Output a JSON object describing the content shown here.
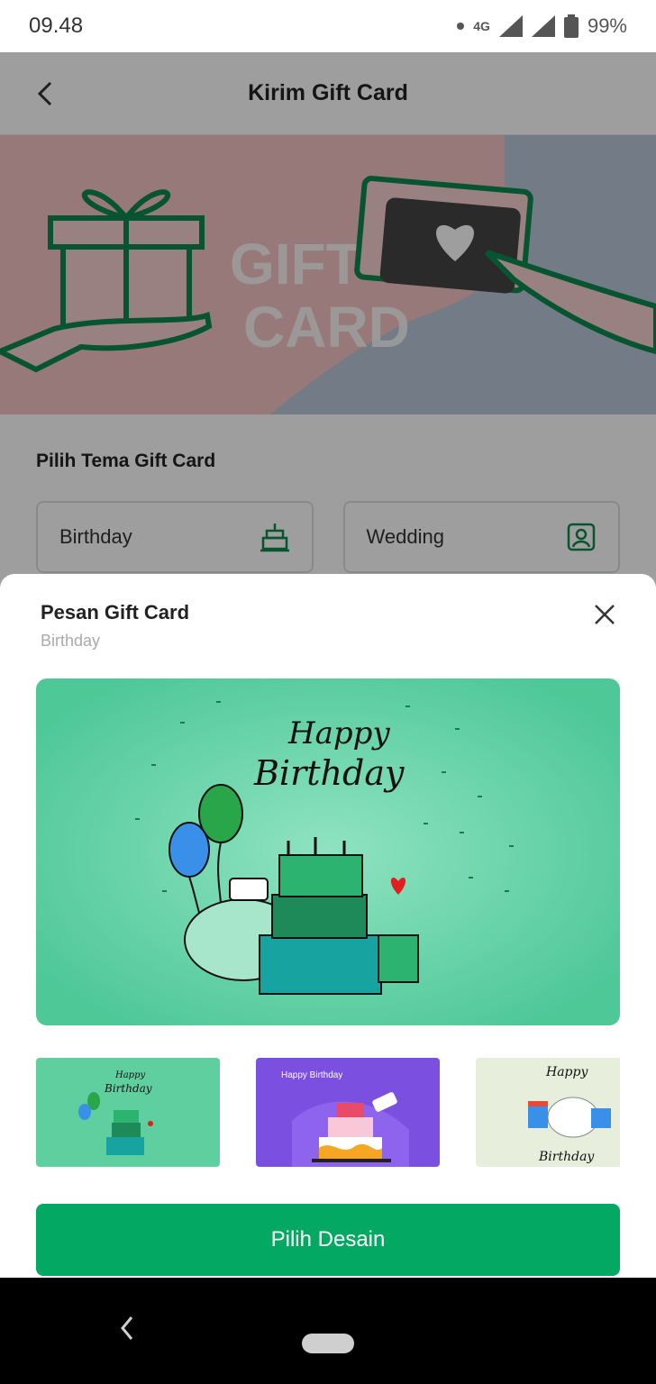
{
  "status_bar": {
    "time": "09.48",
    "network": "4G",
    "battery": "99%"
  },
  "header": {
    "title": "Kirim Gift Card",
    "back_icon": "back-arrow-icon"
  },
  "banner": {
    "text_line1": "GIFT",
    "text_line2": "CARD"
  },
  "theme_section": {
    "title": "Pilih Tema Gift Card",
    "options": [
      {
        "label": "Birthday",
        "icon": "cake-icon"
      },
      {
        "label": "Wedding",
        "icon": "wedding-photo-icon"
      }
    ]
  },
  "sheet": {
    "title": "Pesan Gift Card",
    "subtitle": "Birthday",
    "close_icon": "close-icon",
    "preview": {
      "line1": "Happy",
      "line2": "Birthday"
    },
    "thumbnails": [
      {
        "line1": "Happy",
        "line2": "Birthday",
        "colors": [
          "#5fcf9f"
        ]
      },
      {
        "text": "Happy Birthday",
        "colors": [
          "#7b4fe0"
        ]
      },
      {
        "line1": "Happy",
        "line2": "Birthday",
        "colors": [
          "#e7efdc"
        ]
      }
    ],
    "cta_label": "Pilih Desain"
  },
  "colors": {
    "primary_green": "#03a862",
    "scrim": "rgba(0,0,0,0.38)"
  }
}
